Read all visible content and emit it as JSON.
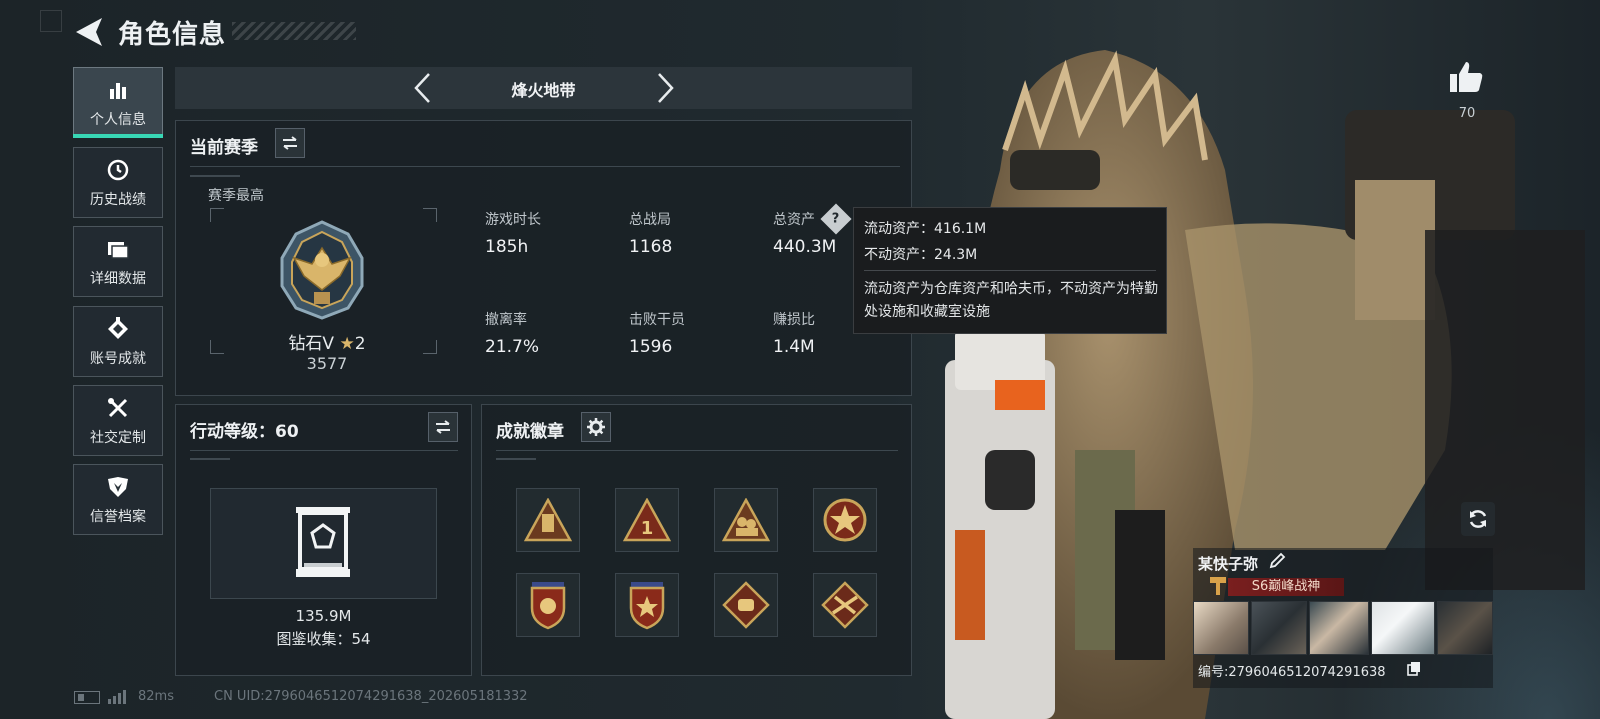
{
  "header": {
    "title": "角色信息"
  },
  "nav": {
    "items": [
      {
        "label": "个人信息",
        "icon": "bar-chart-icon",
        "active": true
      },
      {
        "label": "历史战绩",
        "icon": "history-clock-icon",
        "active": false
      },
      {
        "label": "详细数据",
        "icon": "folder-icon",
        "active": false
      },
      {
        "label": "账号成就",
        "icon": "achievement-icon",
        "active": false
      },
      {
        "label": "社交定制",
        "icon": "tools-icon",
        "active": false
      },
      {
        "label": "信誉档案",
        "icon": "credit-shield-icon",
        "active": false
      }
    ]
  },
  "mode": {
    "title": "烽火地带"
  },
  "season": {
    "title": "当前赛季",
    "best_label": "赛季最高",
    "rank_name": "钻石V",
    "rank_stars": "2",
    "rank_score": "3577",
    "stats": {
      "play_time": {
        "label": "游戏时长",
        "value": "185h"
      },
      "total_matches": {
        "label": "总战局",
        "value": "1168"
      },
      "total_assets": {
        "label": "总资产",
        "value": "440.3M"
      },
      "extract_rate": {
        "label": "撤离率",
        "value": "21.7%"
      },
      "kills": {
        "label": "击败干员",
        "value": "1596"
      },
      "profit_ratio": {
        "label": "赚损比",
        "value": "1.4M"
      }
    }
  },
  "tooltip": {
    "liquid": "流动资产：416.1M",
    "fixed": "不动资产：24.3M",
    "desc": "流动资产为仓库资产和哈夫币，不动资产为特勤处设施和收藏室设施"
  },
  "level": {
    "title": "行动等级：60",
    "value": "135.9M",
    "collection": "图鉴收集：54"
  },
  "badges": {
    "title": "成就徽章",
    "items": [
      "badge-1",
      "badge-2",
      "badge-3",
      "badge-4",
      "badge-5",
      "badge-6",
      "badge-7",
      "badge-8"
    ]
  },
  "profile": {
    "likes": "70",
    "name": "某快子弥",
    "title_text": "S6巅峰战神",
    "id_text": "编号:2796046512074291638"
  },
  "footer": {
    "ping": "82ms",
    "uid": "CN UID:2796046512074291638_202605181332"
  },
  "colors": {
    "accent": "#38d7b5",
    "panel": "#1a2126",
    "title_red": "#7a1f1f"
  }
}
